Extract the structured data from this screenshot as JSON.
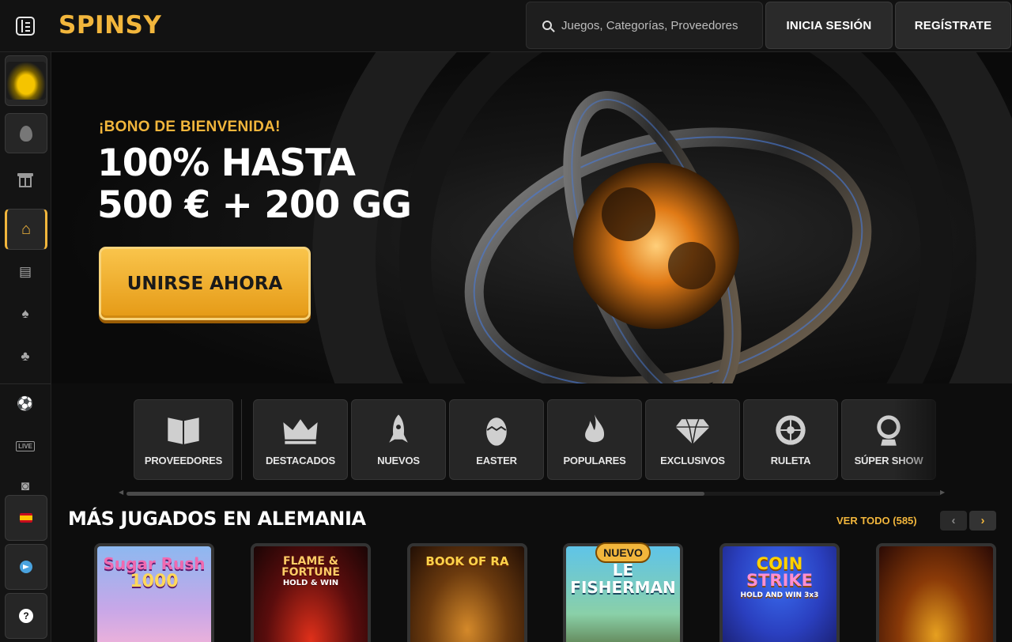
{
  "header": {
    "logo": "SPINSY",
    "search_placeholder": "Juegos, Categorías, Proveedores",
    "login_label": "INICIA SESIÓN",
    "register_label": "REGÍSTRATE"
  },
  "sidebar": {
    "items": [
      {
        "icon": "promo-car-thumbnail"
      },
      {
        "icon": "easter-egg-icon"
      },
      {
        "icon": "gift-icon"
      },
      {
        "icon": "home-icon",
        "active": true
      },
      {
        "icon": "slot-machine-icon"
      },
      {
        "icon": "cards-icon"
      },
      {
        "icon": "clover-icon"
      },
      {
        "icon": "soccer-ball-icon"
      },
      {
        "icon": "live-icon",
        "label": "LIVE"
      },
      {
        "icon": "sports-icon"
      },
      {
        "icon": "spain-flag-icon"
      },
      {
        "icon": "telegram-icon"
      },
      {
        "icon": "help-icon",
        "label": "?"
      }
    ]
  },
  "hero": {
    "subtitle": "¡BONO DE BIENVENIDA!",
    "title_line1": "100% HASTA",
    "title_line2": "500 € + 200 GG",
    "cta_label": "UNIRSE AHORA"
  },
  "categories": [
    {
      "label": "PROVEEDORES",
      "icon": "book-icon"
    },
    {
      "label": "DESTACADOS",
      "icon": "crown-icon"
    },
    {
      "label": "NUEVOS",
      "icon": "rocket-icon"
    },
    {
      "label": "EASTER",
      "icon": "egg-icon"
    },
    {
      "label": "POPULARES",
      "icon": "flame-icon"
    },
    {
      "label": "EXCLUSIVOS",
      "icon": "diamond-icon"
    },
    {
      "label": "RULETA",
      "icon": "roulette-icon"
    },
    {
      "label": "SÚPER SHOW",
      "icon": "wheel-icon"
    }
  ],
  "section": {
    "title": "MÁS JUGADOS EN ALEMANIA",
    "view_all": "VER TODO (585)",
    "prev": "‹",
    "next": "›"
  },
  "games": [
    {
      "title": "Sugar Rush 1000",
      "line1": "Sugar Rush",
      "line2": "1000"
    },
    {
      "title": "Flame & Fortune Hold & Win",
      "line1": "FLAME & FORTUNE",
      "line2": "HOLD & WIN"
    },
    {
      "title": "Book of Ra",
      "line1": "BOOK OF RA",
      "line2": ""
    },
    {
      "title": "Le Fisherman",
      "line1": "LE",
      "line2": "FISHERMAN",
      "badge": "NUEVO"
    },
    {
      "title": "Coin Strike Hold and Win 3x3",
      "line1": "COIN",
      "line2": "STRIKE",
      "line3": "HOLD AND WIN 3x3"
    },
    {
      "title": "",
      "line1": "",
      "line2": ""
    }
  ],
  "colors": {
    "accent": "#f2b63c",
    "background": "#0d0d0d",
    "panel": "#262626"
  }
}
